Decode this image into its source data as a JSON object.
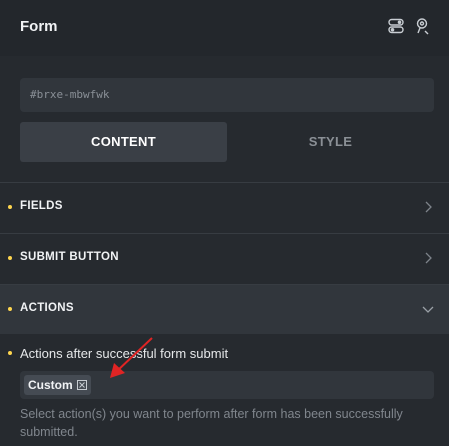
{
  "header": {
    "title": "Form",
    "icons": [
      "toggle-layout-icon",
      "pin-icon"
    ]
  },
  "element_id": "#brxe-mbwfwk",
  "tabs": [
    {
      "label": "CONTENT",
      "active": true
    },
    {
      "label": "STYLE",
      "active": false
    }
  ],
  "sections": [
    {
      "label": "FIELDS",
      "expanded": false
    },
    {
      "label": "SUBMIT BUTTON",
      "expanded": false
    },
    {
      "label": "ACTIONS",
      "expanded": true
    }
  ],
  "actions_control": {
    "label": "Actions after successful form submit",
    "selected": [
      "Custom"
    ],
    "help": "Select action(s) you want to perform after form has been successfully submitted."
  },
  "colors": {
    "background": "#262a2f",
    "indicator_dot": "#ffd64f",
    "annotation_arrow": "#e02424"
  }
}
